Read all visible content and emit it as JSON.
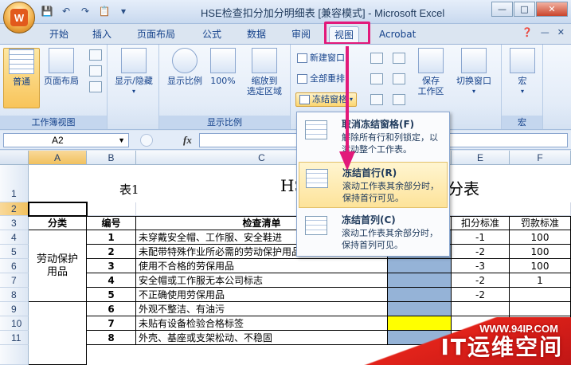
{
  "window": {
    "title": "HSE检查扣分加分明细表 [兼容模式] - Microsoft Excel",
    "office_logo": "W"
  },
  "tabs": [
    {
      "label": "开始",
      "active": false
    },
    {
      "label": "插入",
      "active": false
    },
    {
      "label": "页面布局",
      "active": false
    },
    {
      "label": "公式",
      "active": false
    },
    {
      "label": "数据",
      "active": false
    },
    {
      "label": "审阅",
      "active": false
    },
    {
      "label": "视图",
      "active": true
    },
    {
      "label": "Acrobat",
      "active": false
    }
  ],
  "ribbon": {
    "workbook_views": {
      "label": "工作簿视图",
      "normal": "普通",
      "page_layout": "页面布局"
    },
    "show_hide": {
      "label": "显示/隐藏"
    },
    "zoom": {
      "label": "显示比例",
      "zoom": "显示比例",
      "hundred": "100%",
      "zoom_selection_1": "缩放到",
      "zoom_selection_2": "选定区域"
    },
    "window": {
      "new_window": "新建窗口",
      "arrange_all": "全部重排",
      "freeze_panes": "冻结窗格",
      "save_workspace_1": "保存",
      "save_workspace_2": "工作区",
      "switch_windows": "切换窗口"
    },
    "macros": {
      "label": "宏",
      "macro": "宏"
    }
  },
  "formula_bar": {
    "name_box": "A2",
    "fx": "fx"
  },
  "freeze_menu": {
    "items": [
      {
        "title": "取消冻结窗格(F)",
        "desc": "解除所有行和列锁定，以滚动整个工作表。"
      },
      {
        "title": "冻结首行(R)",
        "desc": "滚动工作表其余部分时，保持首行可见。"
      },
      {
        "title": "冻结首列(C)",
        "desc": "滚动工作表其余部分时，保持首列可见。"
      }
    ]
  },
  "sheet": {
    "columns": [
      "A",
      "B",
      "C",
      "D",
      "E",
      "F"
    ],
    "rows": [
      "1",
      "2",
      "3",
      "4",
      "5",
      "6",
      "7",
      "8",
      "9",
      "10",
      "11"
    ],
    "row1": {
      "a": "表1",
      "title_left": "HS",
      "title_right": "分表"
    },
    "headers": {
      "category": "分类",
      "no": "编号",
      "checklist": "检查清单",
      "deduct": "扣分标准",
      "penalty": "罚款标准"
    },
    "category_merged": "劳动保护用品",
    "data_rows": [
      {
        "no": "1",
        "item": "未穿戴安全帽、工作服、安全鞋进",
        "deduct": "-1",
        "penalty": "100"
      },
      {
        "no": "2",
        "item": "未配带特殊作业所必需的劳动保护用品进行作业",
        "deduct": "-2",
        "penalty": "100"
      },
      {
        "no": "3",
        "item": "使用不合格的劳保用品",
        "deduct": "-3",
        "penalty": "100"
      },
      {
        "no": "4",
        "item": "安全帽或工作服无本公司标志",
        "deduct": "-2",
        "penalty": "1"
      },
      {
        "no": "5",
        "item": "不正确使用劳保用品",
        "deduct": "-2",
        "penalty": ""
      },
      {
        "no": "6",
        "item": "外观不整洁、有油污",
        "deduct": "",
        "penalty": ""
      },
      {
        "no": "7",
        "item": "未贴有设备检验合格标签",
        "deduct": "",
        "penalty": ""
      },
      {
        "no": "8",
        "item": "外壳、基座或支架松动、不稳固",
        "deduct": "",
        "penalty": ""
      }
    ]
  },
  "watermark": {
    "line1": "WWW.94IP.COM",
    "line2": "IT运维空间"
  },
  "colors": {
    "accent_pink": "#e2197a",
    "ribbon_blue": "#15428b",
    "highlight_yellow": "#ffff00",
    "fill_blue": "#95b3d7"
  }
}
